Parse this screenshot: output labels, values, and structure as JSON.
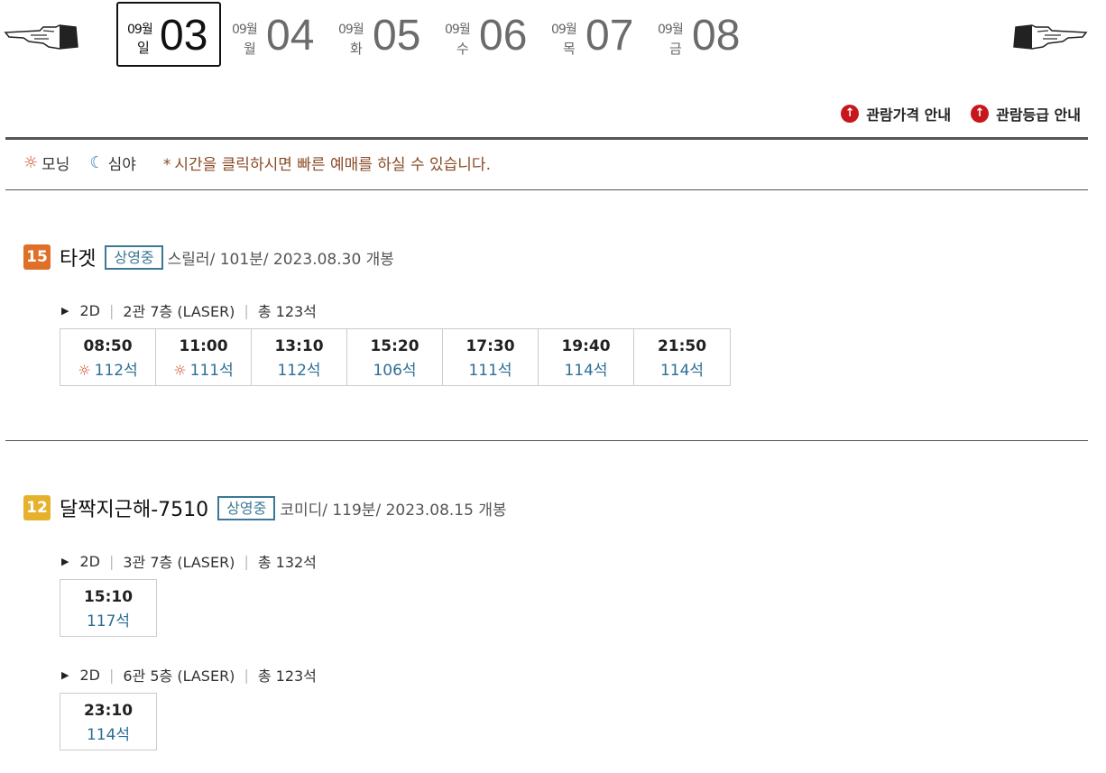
{
  "nav": {
    "prev_icon": "pointing-hand-left-icon",
    "next_icon": "pointing-hand-right-icon"
  },
  "dates": [
    {
      "month": "09월",
      "dow": "일",
      "day": "03",
      "active": true
    },
    {
      "month": "09월",
      "dow": "월",
      "day": "04",
      "active": false
    },
    {
      "month": "09월",
      "dow": "화",
      "day": "05",
      "active": false
    },
    {
      "month": "09월",
      "dow": "수",
      "day": "06",
      "active": false
    },
    {
      "month": "09월",
      "dow": "목",
      "day": "07",
      "active": false
    },
    {
      "month": "09월",
      "dow": "금",
      "day": "08",
      "active": false
    }
  ],
  "info_links": [
    {
      "label": "관람가격 안내",
      "icon": "red-up-arrow-icon"
    },
    {
      "label": "관람등급 안내",
      "icon": "red-up-arrow-icon"
    }
  ],
  "legend": {
    "morning": "모닝",
    "late_night": "심야",
    "notice_mark": "*",
    "notice": "시간을 클릭하시면 빠른 예매를 하실 수 있습니다."
  },
  "movies": [
    {
      "rating": "15",
      "title": "타겟",
      "status": "상영중",
      "meta": "스릴러/ 101분/ 2023.08.30 개봉",
      "halls": [
        {
          "format": "2D",
          "hall": "2관 7층 (LASER)",
          "total": "총 123석",
          "showtimes": [
            {
              "time": "08:50",
              "seats": "112석",
              "morning": true
            },
            {
              "time": "11:00",
              "seats": "111석",
              "morning": true
            },
            {
              "time": "13:10",
              "seats": "112석",
              "morning": false
            },
            {
              "time": "15:20",
              "seats": "106석",
              "morning": false
            },
            {
              "time": "17:30",
              "seats": "111석",
              "morning": false
            },
            {
              "time": "19:40",
              "seats": "114석",
              "morning": false
            },
            {
              "time": "21:50",
              "seats": "114석",
              "morning": false
            }
          ]
        }
      ]
    },
    {
      "rating": "12",
      "title": "달짝지근해-7510",
      "status": "상영중",
      "meta": "코미디/ 119분/ 2023.08.15 개봉",
      "halls": [
        {
          "format": "2D",
          "hall": "3관 7층 (LASER)",
          "total": "총 132석",
          "showtimes": [
            {
              "time": "15:10",
              "seats": "117석",
              "morning": false
            }
          ]
        },
        {
          "format": "2D",
          "hall": "6관 5층 (LASER)",
          "total": "총 123석",
          "showtimes": [
            {
              "time": "23:10",
              "seats": "114석",
              "morning": false
            }
          ]
        }
      ]
    }
  ],
  "colors": {
    "accent_blue": "#2d6f95",
    "status_border": "#3a7894",
    "rating_15": "#e07027",
    "rating_12": "#e6b22d",
    "info_icon": "#c8161d",
    "morning_icon": "#d2502c"
  }
}
